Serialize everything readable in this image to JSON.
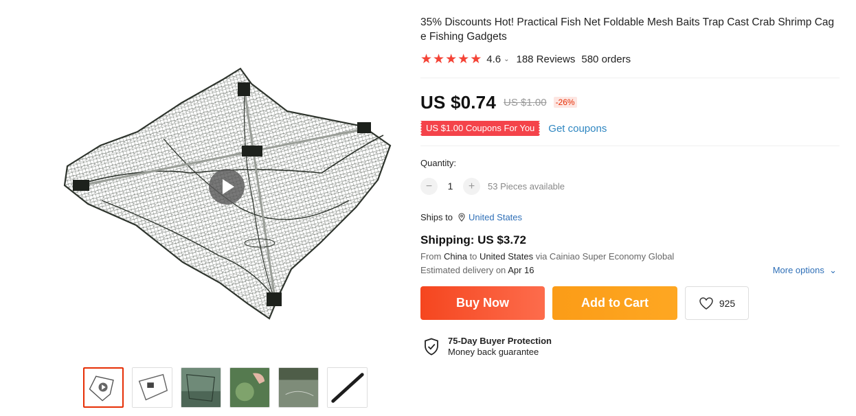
{
  "product": {
    "title": "35% Discounts Hot! Practical Fish Net Foldable Mesh Baits Trap Cast Crab Shrimp Cage Fishing Gadgets",
    "rating": "4.6",
    "reviews": "188 Reviews",
    "orders": "580 orders",
    "star_color": "#f44336"
  },
  "price": {
    "current": "US $0.74",
    "original": "US $1.00",
    "discount": "-26%"
  },
  "coupon": {
    "tag": "US $1.00 Coupons For You",
    "link": "Get coupons"
  },
  "quantity": {
    "label": "Quantity:",
    "value": "1",
    "minus": "−",
    "plus": "+",
    "available": "53 Pieces available"
  },
  "shipping": {
    "ships_to_label": "Ships to",
    "ships_to_country": "United States",
    "title": "Shipping: US $3.72",
    "from_prefix": "From",
    "from_country": "China",
    "to_word": "to",
    "to_country": "United States",
    "via": "via Cainiao Super Economy Global",
    "delivery_prefix": "Estimated delivery on",
    "delivery_date": "Apr 16",
    "more_options": "More options"
  },
  "actions": {
    "buy_now": "Buy Now",
    "add_to_cart": "Add to Cart",
    "wishlist_count": "925"
  },
  "protection": {
    "title": "75-Day Buyer Protection",
    "subtitle": "Money back guarantee"
  },
  "gallery": {
    "thumbnails": [
      "net-video",
      "net-folded",
      "net-underwater",
      "net-hand",
      "net-pond",
      "net-rod"
    ],
    "active_index": 0
  },
  "colors": {
    "buy_now": "#f5461f",
    "add_to_cart": "#fb9c17",
    "link": "#2e6fb7",
    "coupon": "#f4434a"
  }
}
